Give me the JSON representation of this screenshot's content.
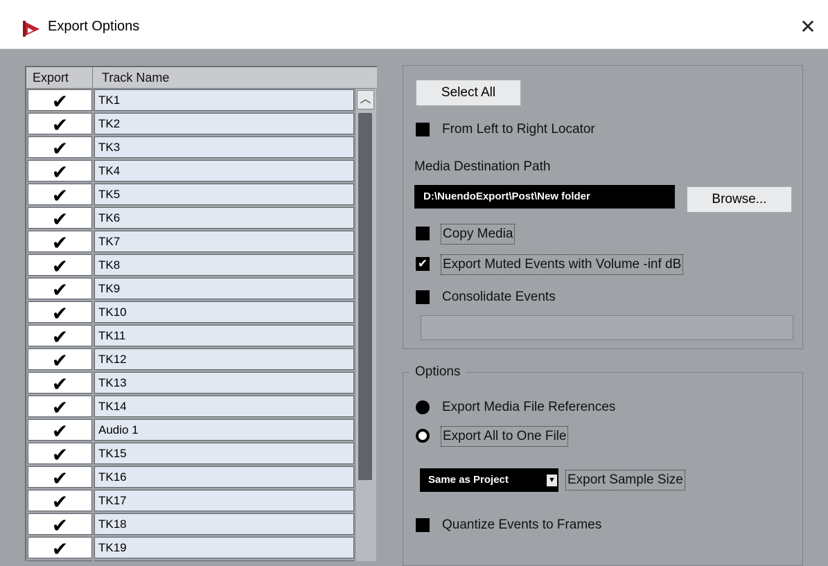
{
  "window": {
    "title": "Export Options",
    "close_glyph": "✕"
  },
  "icons": {
    "app": "nuendo-logo-icon",
    "close": "close-icon",
    "check": "checkmark-icon"
  },
  "table": {
    "col_export": "Export",
    "col_track_name": "Track Name",
    "rows": [
      {
        "export": "✔",
        "name": "TK1"
      },
      {
        "export": "✔",
        "name": "TK2"
      },
      {
        "export": "✔",
        "name": "TK3"
      },
      {
        "export": "✔",
        "name": "TK4"
      },
      {
        "export": "✔",
        "name": "TK5"
      },
      {
        "export": "✔",
        "name": "TK6"
      },
      {
        "export": "✔",
        "name": "TK7"
      },
      {
        "export": "✔",
        "name": "TK8"
      },
      {
        "export": "✔",
        "name": "TK9"
      },
      {
        "export": "✔",
        "name": "TK10"
      },
      {
        "export": "✔",
        "name": "TK11"
      },
      {
        "export": "✔",
        "name": "TK12"
      },
      {
        "export": "✔",
        "name": "TK13"
      },
      {
        "export": "✔",
        "name": "TK14"
      },
      {
        "export": "✔",
        "name": "Audio 1"
      },
      {
        "export": "✔",
        "name": "TK15"
      },
      {
        "export": "✔",
        "name": "TK16"
      },
      {
        "export": "✔",
        "name": "TK17"
      },
      {
        "export": "✔",
        "name": "TK18"
      },
      {
        "export": "✔",
        "name": "TK19"
      },
      {
        "export": "✔",
        "name": ""
      }
    ],
    "scroll_up_glyph": "︿"
  },
  "top_group": {
    "select_all": "Select All",
    "from_left_to_right": {
      "label": "From Left to Right Locator",
      "checked": false
    },
    "media_path_label": "Media Destination Path",
    "media_path_value": "D:\\NuendoExport\\Post\\New folder",
    "browse": "Browse...",
    "copy_media": {
      "label": "Copy Media",
      "checked": false
    },
    "export_muted": {
      "label": "Export Muted Events with Volume -inf dB",
      "checked": true,
      "glyph": "✔"
    },
    "consolidate": {
      "label": "Consolidate Events",
      "checked": false
    },
    "progress_value": ""
  },
  "options_group": {
    "legend": "Options",
    "export_refs": {
      "label": "Export Media File References",
      "selected": true
    },
    "export_one_file": {
      "label": "Export All to One File",
      "selected": false
    },
    "sample_size_value": "Same as Project",
    "sample_size_arrow": "▼",
    "sample_size_label": "Export Sample Size",
    "quantize": {
      "label": "Quantize Events to Frames",
      "checked": false
    }
  },
  "colors": {
    "dialog_bg": "#9fa3a8",
    "track_name_cell": "#e2e8f1",
    "checkbox_fill": "#000000",
    "logo_red": "#c0202c"
  }
}
